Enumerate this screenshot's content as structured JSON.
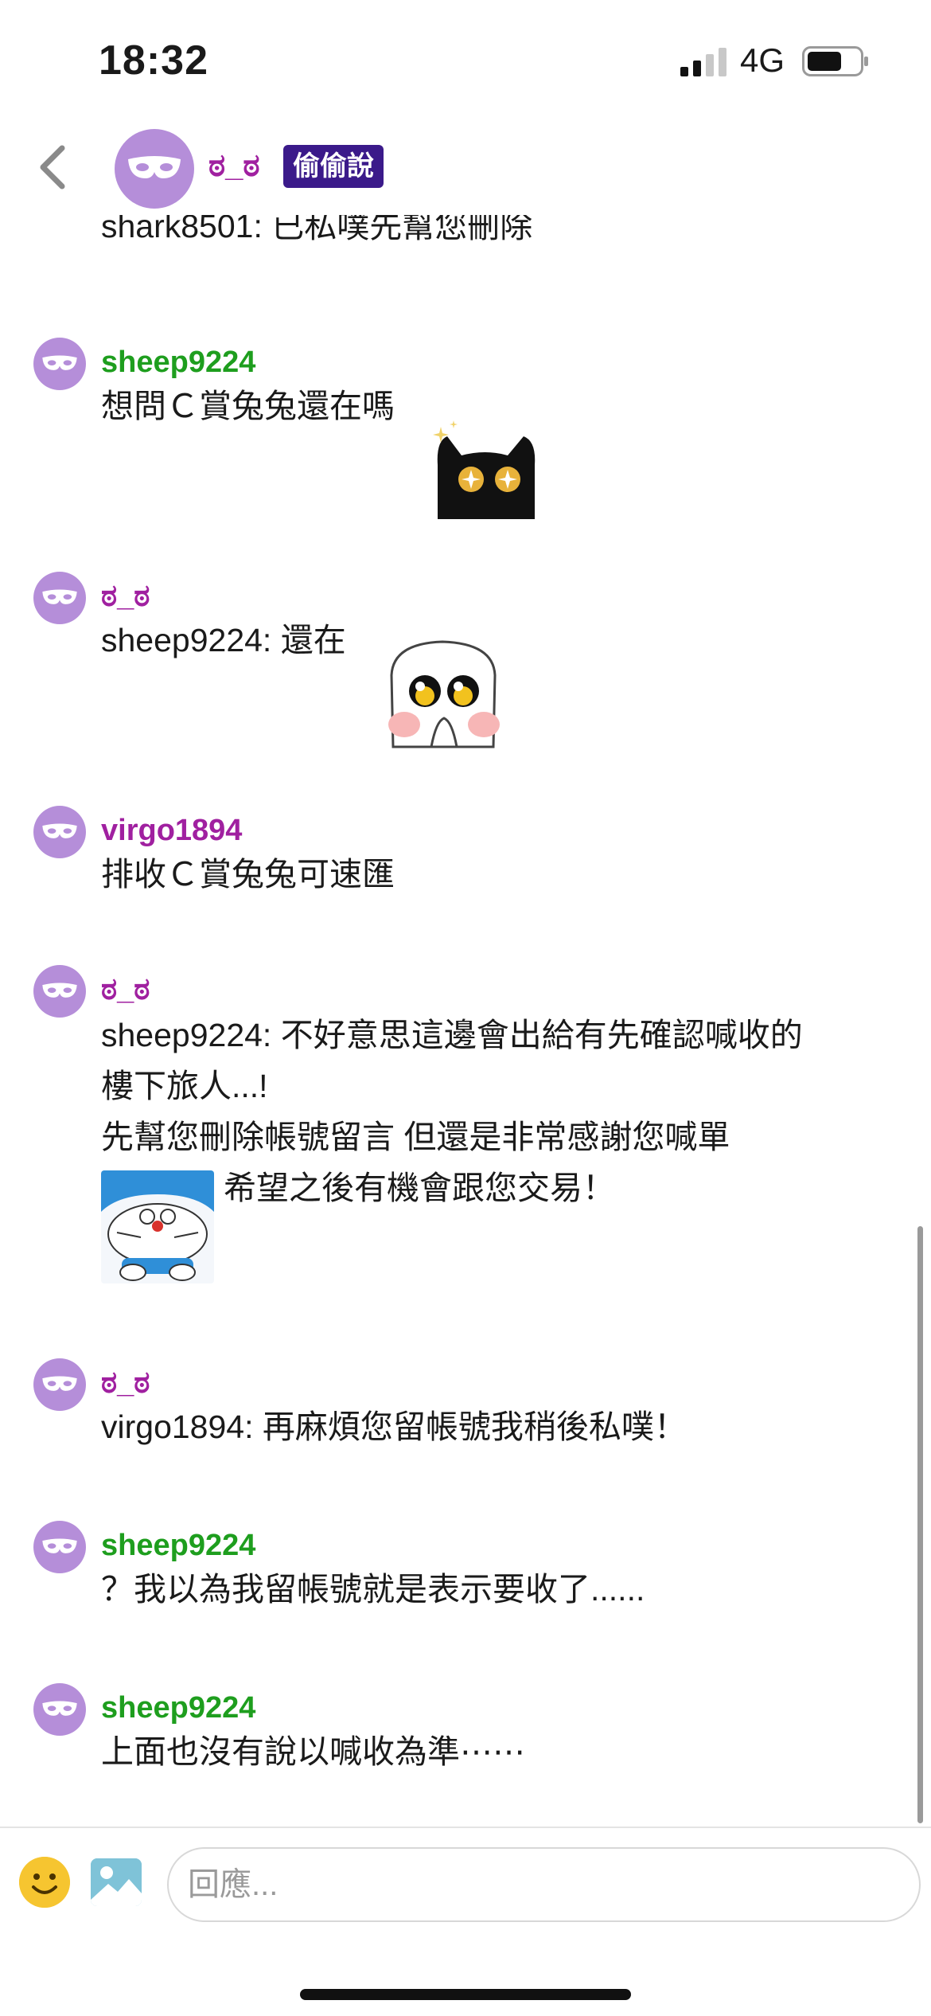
{
  "status_bar": {
    "time": "18:32",
    "network": "4G"
  },
  "header": {
    "name": "ಠ_ಠ",
    "badge": "偷偷說"
  },
  "messages": [
    {
      "username": "",
      "text": "shark8501: 已私噗先幫您刪除"
    },
    {
      "username": "sheep9224",
      "text": "想問Ｃ賞兔兔還在嗎",
      "sticker": "black-cat-sparkle-eyes-sticker"
    },
    {
      "username": "ಠ_ಠ",
      "text": "sheep9224: 還在",
      "sticker": "white-cat-teary-eyes-sticker"
    },
    {
      "username": "virgo1894",
      "text": "排收Ｃ賞兔兔可速匯"
    },
    {
      "username": "ಠ_ಠ",
      "line1": "sheep9224: 不好意思這邊會出給有先確認喊收的",
      "line2": "樓下旅人...!",
      "line3": "先幫您刪除帳號留言 但還是非常感謝您喊單",
      "line4": "希望之後有機會跟您交易！",
      "sticker": "doraemon-bowing-sticker"
    },
    {
      "username": "ಠ_ಠ",
      "text": "virgo1894: 再麻煩您留帳號我稍後私噗！"
    },
    {
      "username": "sheep9224",
      "text": "？我以為我留帳號就是表示要收了......"
    },
    {
      "username": "sheep9224",
      "text": "上面也沒有說以喊收為準⋯⋯"
    }
  ],
  "input": {
    "placeholder": "回應..."
  },
  "icons": {
    "back": "chevron-left-icon",
    "mask": "mask-icon",
    "emoji": "smiley-icon",
    "image": "image-icon"
  },
  "colors": {
    "accent_purple": "#a020a0",
    "green_name": "#1e9e1e",
    "avatar_bg": "#b58ed9",
    "badge_bg": "#3b1a8a"
  }
}
